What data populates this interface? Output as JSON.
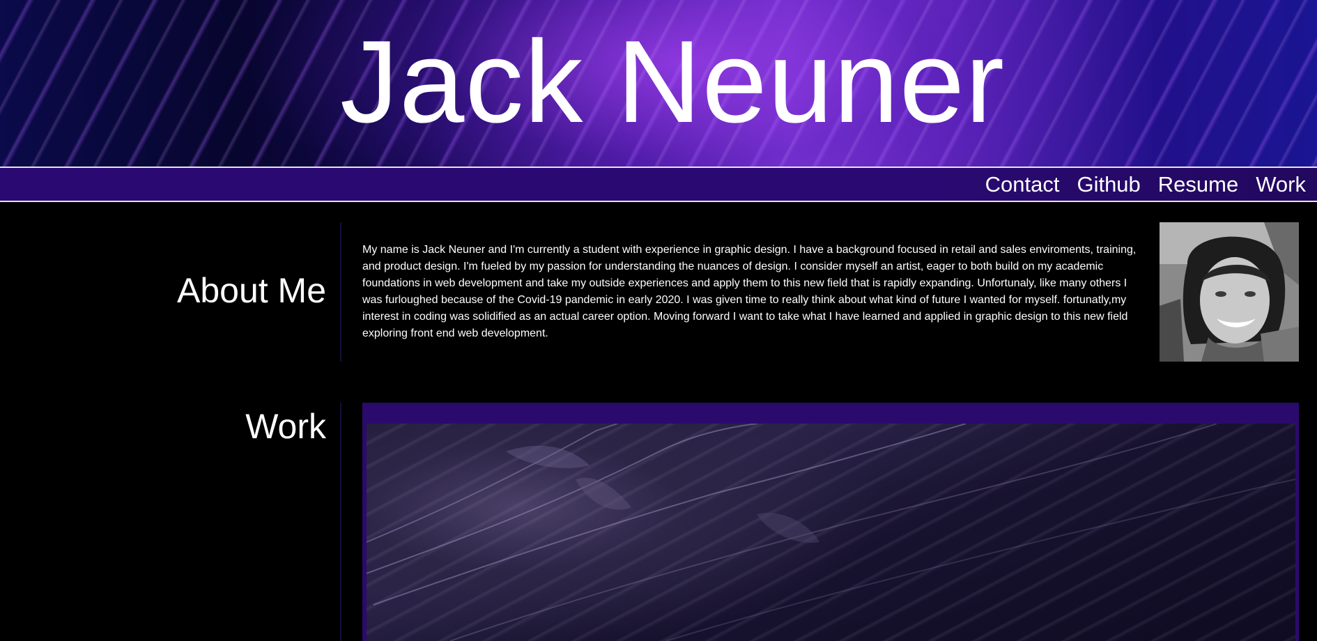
{
  "header": {
    "title": "Jack Neuner"
  },
  "nav": {
    "items": [
      {
        "label": "Contact"
      },
      {
        "label": "Github"
      },
      {
        "label": "Resume"
      },
      {
        "label": "Work"
      }
    ]
  },
  "about": {
    "heading": "About Me",
    "body": "My name is Jack Neuner and I'm currently a student with experience in graphic design. I have a background focused in retail and sales enviroments, training, and product design. I'm fueled by my passion for understanding the nuances of design. I consider myself an artist, eager to both build on my academic foundations in web development and take my outside experiences and apply them to this new field that is rapidly expanding. Unfortunaly, like many others I was furloughed because of the Covid-19 pandemic in early 2020. I was given time to really think about what kind of future I wanted for myself. fortunatly,my interest in coding was solidified as an actual career option. Moving forward I want to take what I have learned and applied in graphic design to this new field exploring front end web development."
  },
  "work": {
    "heading": "Work"
  },
  "colors": {
    "nav_background": "#2a0a72",
    "work_frame": "#2b0a6e",
    "page_background": "#000000",
    "text": "#ffffff"
  }
}
